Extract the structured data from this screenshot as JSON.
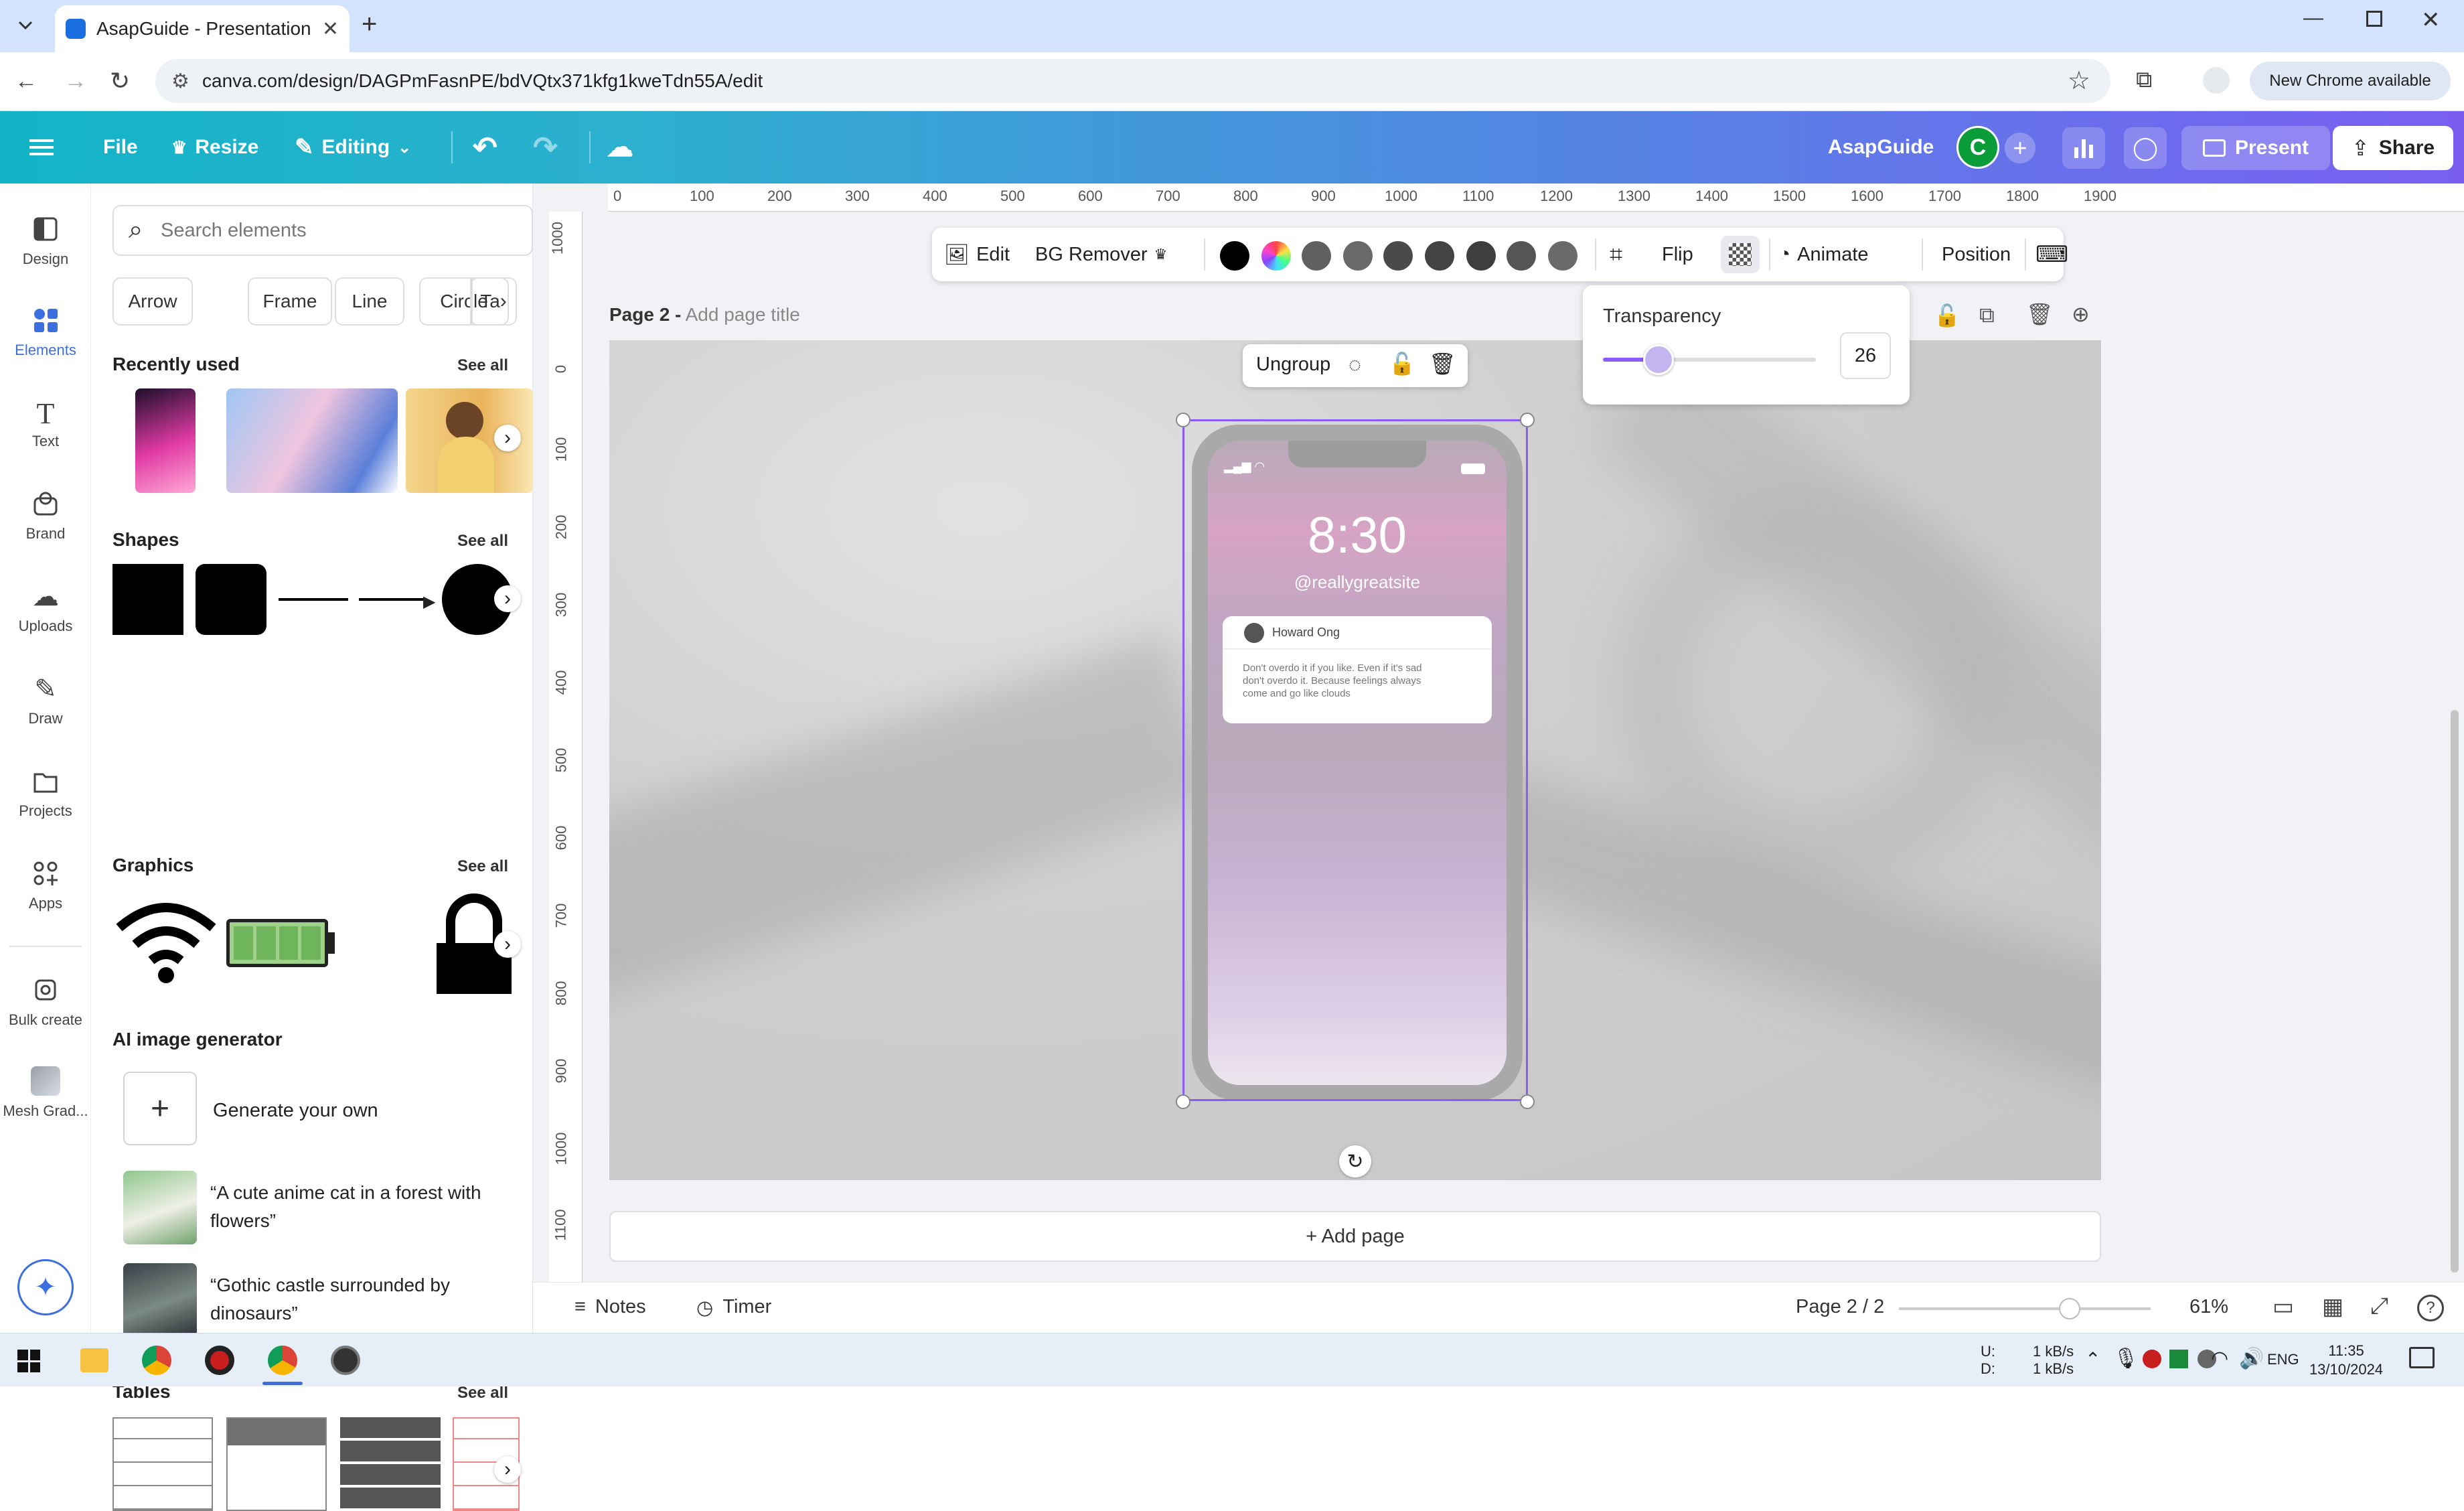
{
  "browser": {
    "tab_title": "AsapGuide - Presentation",
    "url": "canva.com/design/DAGPmFasnPE/bdVQtx371kfg1kweTdn55A/edit",
    "chrome_badge": "New Chrome available"
  },
  "header": {
    "file": "File",
    "resize": "Resize",
    "editing": "Editing",
    "team_name": "AsapGuide",
    "avatar_initial": "C",
    "present": "Present",
    "share": "Share",
    "brand_color": "#13b4c7",
    "accent_color": "#7a5ef2"
  },
  "rail": {
    "items": [
      {
        "label": "Design",
        "icon": "design-icon"
      },
      {
        "label": "Elements",
        "icon": "elements-icon"
      },
      {
        "label": "Text",
        "icon": "text-icon"
      },
      {
        "label": "Brand",
        "icon": "brand-icon"
      },
      {
        "label": "Uploads",
        "icon": "uploads-icon"
      },
      {
        "label": "Draw",
        "icon": "draw-icon"
      },
      {
        "label": "Projects",
        "icon": "projects-icon"
      },
      {
        "label": "Apps",
        "icon": "apps-icon"
      },
      {
        "label": "Bulk create",
        "icon": "bulk-create-icon"
      },
      {
        "label": "Mesh Grad...",
        "icon": "mesh-gradient-icon"
      }
    ]
  },
  "panel": {
    "search_placeholder": "Search elements",
    "chips": [
      "Arrow",
      "Frame",
      "Line",
      "Circle",
      "Ta"
    ],
    "recently_used": "Recently used",
    "shapes": "Shapes",
    "graphics": "Graphics",
    "ai_generator": "AI image generator",
    "generate_your_own": "Generate your own",
    "prompts": [
      "“A cute anime cat in a forest with",
      "flowers”",
      "“Gothic castle surrounded by",
      "dinosaurs”"
    ],
    "tables": "Tables",
    "see_all": "See all"
  },
  "ruler": {
    "h": [
      "0",
      "100",
      "200",
      "300",
      "400",
      "500",
      "600",
      "700",
      "800",
      "900",
      "1000",
      "1100",
      "1200",
      "1300",
      "1400",
      "1500",
      "1600",
      "1700",
      "1800",
      "1900"
    ],
    "v": [
      "1000",
      "0",
      "100",
      "200",
      "300",
      "400",
      "500",
      "600",
      "700",
      "800",
      "900",
      "1000",
      "1100"
    ]
  },
  "toolbar": {
    "edit": "Edit",
    "bg_remover": "BG Remover",
    "flip": "Flip",
    "animate": "Animate",
    "position": "Position",
    "swatches": [
      "#000000",
      "rainbow",
      "#5f5f5f",
      "#696969",
      "#4a4a4a",
      "#434343",
      "#3e3e3e",
      "#555555",
      "#6a6a6a"
    ]
  },
  "canvas": {
    "page_label": "Page 2 -",
    "page_title_placeholder": "Add page title",
    "ungroup": "Ungroup",
    "add_page": "+ Add page"
  },
  "phone": {
    "time": "8:30",
    "handle": "@reallygreatsite",
    "notif_name": "Howard Ong",
    "notif_text": [
      "Don't overdo it if you like. Even if it's sad",
      "don't overdo it. Because feelings always",
      "come and go like clouds"
    ]
  },
  "transparency": {
    "label": "Transparency",
    "value": "26",
    "level": 0.26
  },
  "footer": {
    "notes": "Notes",
    "timer": "Timer",
    "page_counter": "Page 2 / 2",
    "zoom": "61%",
    "zoom_level": 0.61
  },
  "taskbar": {
    "net_up": "1 kB/s",
    "net_down": "1 kB/s",
    "net_u": "U:",
    "net_d": "D:",
    "lang": "ENG",
    "time": "11:35",
    "date": "13/10/2024"
  }
}
